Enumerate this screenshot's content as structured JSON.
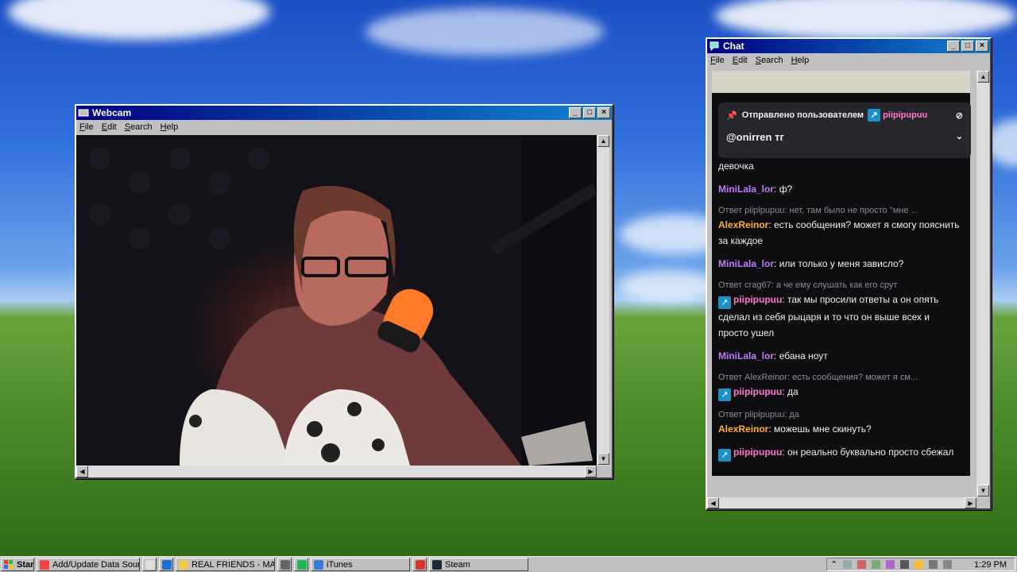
{
  "webcam_window": {
    "title": "Webcam",
    "menu": [
      "File",
      "Edit",
      "Search",
      "Help"
    ]
  },
  "chat_window": {
    "title": "Chat",
    "menu": [
      "File",
      "Edit",
      "Search",
      "Help"
    ],
    "pinned": {
      "header_prefix": "Отправлено пользователем",
      "header_user": "piipipupuu",
      "text": "@onirren тг"
    },
    "partial_line": "девочка",
    "messages": [
      {
        "reply": "",
        "user": "MiniLala_lor",
        "user_color": "#bf7cff",
        "badge": false,
        "text": "ф?"
      },
      {
        "reply": "Ответ piipipupuu: нет, там было не просто \"мне ...",
        "user": "AlexReinor",
        "user_color": "#ffb02e",
        "badge": false,
        "text": "есть сообщения? может я смогу пояснить за каждое"
      },
      {
        "reply": "",
        "user": "MiniLala_lor",
        "user_color": "#bf7cff",
        "badge": false,
        "text": "или только у меня зависло?"
      },
      {
        "reply": "Ответ crag67: а че ему слушать как его срут",
        "user": "piipipupuu",
        "user_color": "#ff7ad1",
        "badge": true,
        "text": "так мы просили ответы а он опять сделал из себя рыцаря и то что он выше всех и просто ушел"
      },
      {
        "reply": "",
        "user": "MiniLala_lor",
        "user_color": "#bf7cff",
        "badge": false,
        "text": "ебана ноут"
      },
      {
        "reply": "Ответ AlexReinor: есть сообщения? может я см...",
        "user": "piipipupuu",
        "user_color": "#ff7ad1",
        "badge": true,
        "text": "да"
      },
      {
        "reply": "Ответ piipipupuu: да",
        "user": "AlexReinor",
        "user_color": "#ffb02e",
        "badge": false,
        "text": "можешь мне скинуть?"
      },
      {
        "reply": "",
        "user": "piipipupuu",
        "user_color": "#ff7ad1",
        "badge": true,
        "text": "он реально буквально просто сбежал"
      }
    ]
  },
  "taskbar": {
    "start": "Start",
    "items": [
      {
        "label": "Add/Update Data Source...",
        "icon": "chrome-icon"
      },
      {
        "label": "",
        "icon": "notepad-icon"
      },
      {
        "label": "",
        "icon": "outlook-icon"
      },
      {
        "label": "REAL FRIENDS - MAYB...",
        "icon": "folder-icon"
      },
      {
        "label": "",
        "icon": "chevron-icon"
      },
      {
        "label": "",
        "icon": "spotify-icon"
      },
      {
        "label": "iTunes",
        "icon": "itunes-icon"
      },
      {
        "label": "",
        "icon": "star-icon"
      },
      {
        "label": "Steam",
        "icon": "steam-icon"
      }
    ],
    "clock": "1:29 PM"
  }
}
